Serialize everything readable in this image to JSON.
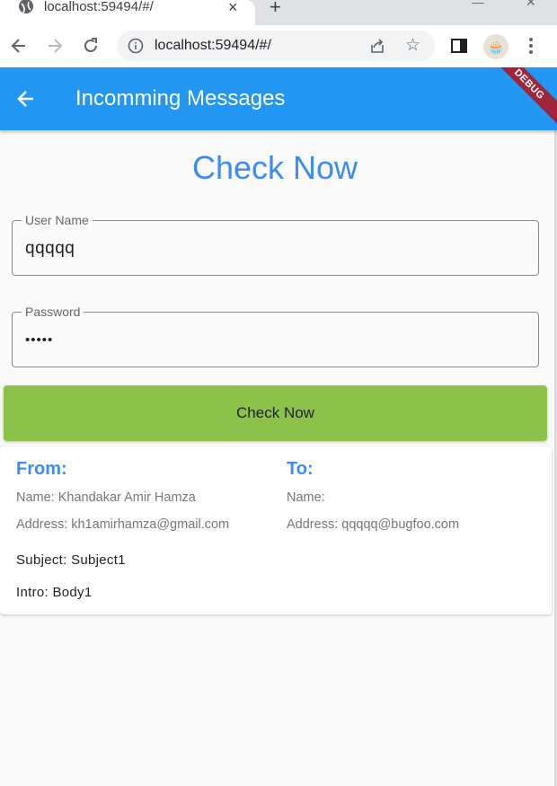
{
  "browser": {
    "tab_title": "localhost:59494/#/",
    "tab_close": "×",
    "new_tab": "+",
    "url_host": "localhost",
    "url_rest": ":59494/#/"
  },
  "appbar": {
    "title": "Incomming Messages",
    "debug_label": "DEBUG",
    "color": "#2196f3"
  },
  "main": {
    "heading": "Check Now",
    "username": {
      "label": "User Name",
      "value": "qqqqq"
    },
    "password": {
      "label": "Password",
      "value": "•••••"
    },
    "check_button": "Check Now",
    "accent_color": "#3d8cf5",
    "button_color": "#8bc34a"
  },
  "message": {
    "from": {
      "title": "From:",
      "name": "Name: Khandakar Amir Hamza",
      "address": "Address: kh1amirhamza@gmail.com"
    },
    "to": {
      "title": "To:",
      "name": "Name:",
      "address": "Address: qqqqq@bugfoo.com"
    },
    "subject": "Subject: Subject1",
    "intro": "Intro: Body1"
  }
}
